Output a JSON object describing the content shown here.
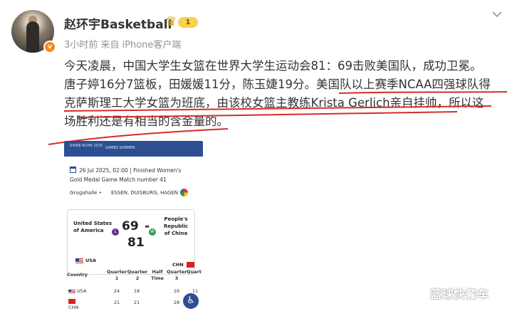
{
  "post": {
    "author": {
      "name": "赵环宇Basketball",
      "vip_level": "1",
      "verified_mark": "v"
    },
    "meta": "3小时前 来自 iPhone客户端",
    "text_lines": [
      "今天凌晨，中国大学生女篮在世界大学生运动会81：69击败美国队，成功卫冕。",
      "唐子婷16分7篮板，田媛媛11分，陈玉婕19分。美国队以上赛季NCAA四强球队得",
      "克萨斯理工大学女篮为班底，由该校女篮主教练Krista Gerlich亲自挂帅，所以这",
      "场胜利还是有相当的含金量的。"
    ],
    "icons": {
      "more": "chevron-down-icon",
      "verified": "verified-badge-icon",
      "vip": "crown-icon"
    }
  },
  "embedded_image": {
    "header_logo": "RHINE-RUHR 2025",
    "header_subtitle": "GAMES SUMMER",
    "date_line": "26 Jul 2025, 02:00  |  Finished   Women's",
    "match_line": "Gold Medal Game   Match number 41",
    "venue_label": "Grugahalle •",
    "venue_value": "ESSEN, DUISBURG, HAGEN",
    "team_a": "United States of America",
    "team_b": "People's Republic of China",
    "score_a": "69",
    "score_separator": "-",
    "score_b": "81",
    "result_a": "L",
    "result_b": "W",
    "code_a": "USA",
    "code_b": "CHN",
    "table": {
      "headers": [
        "Country",
        "Quarter 1",
        "Quarter 2",
        "Half Time",
        "Quarter 3",
        "Quart"
      ],
      "rows": [
        {
          "country": "USA",
          "values": [
            "24",
            "18",
            "",
            "16",
            "11"
          ]
        },
        {
          "country": "CHN",
          "values": [
            "21",
            "21",
            "",
            "28",
            ""
          ]
        }
      ]
    },
    "accessibility_icon": "accessibility-icon"
  },
  "watermark": "篮球快餐车",
  "colors": {
    "underline": "#d62b2b",
    "username": "#333333",
    "meta": "#939393",
    "card_header": "#2d4f91"
  }
}
